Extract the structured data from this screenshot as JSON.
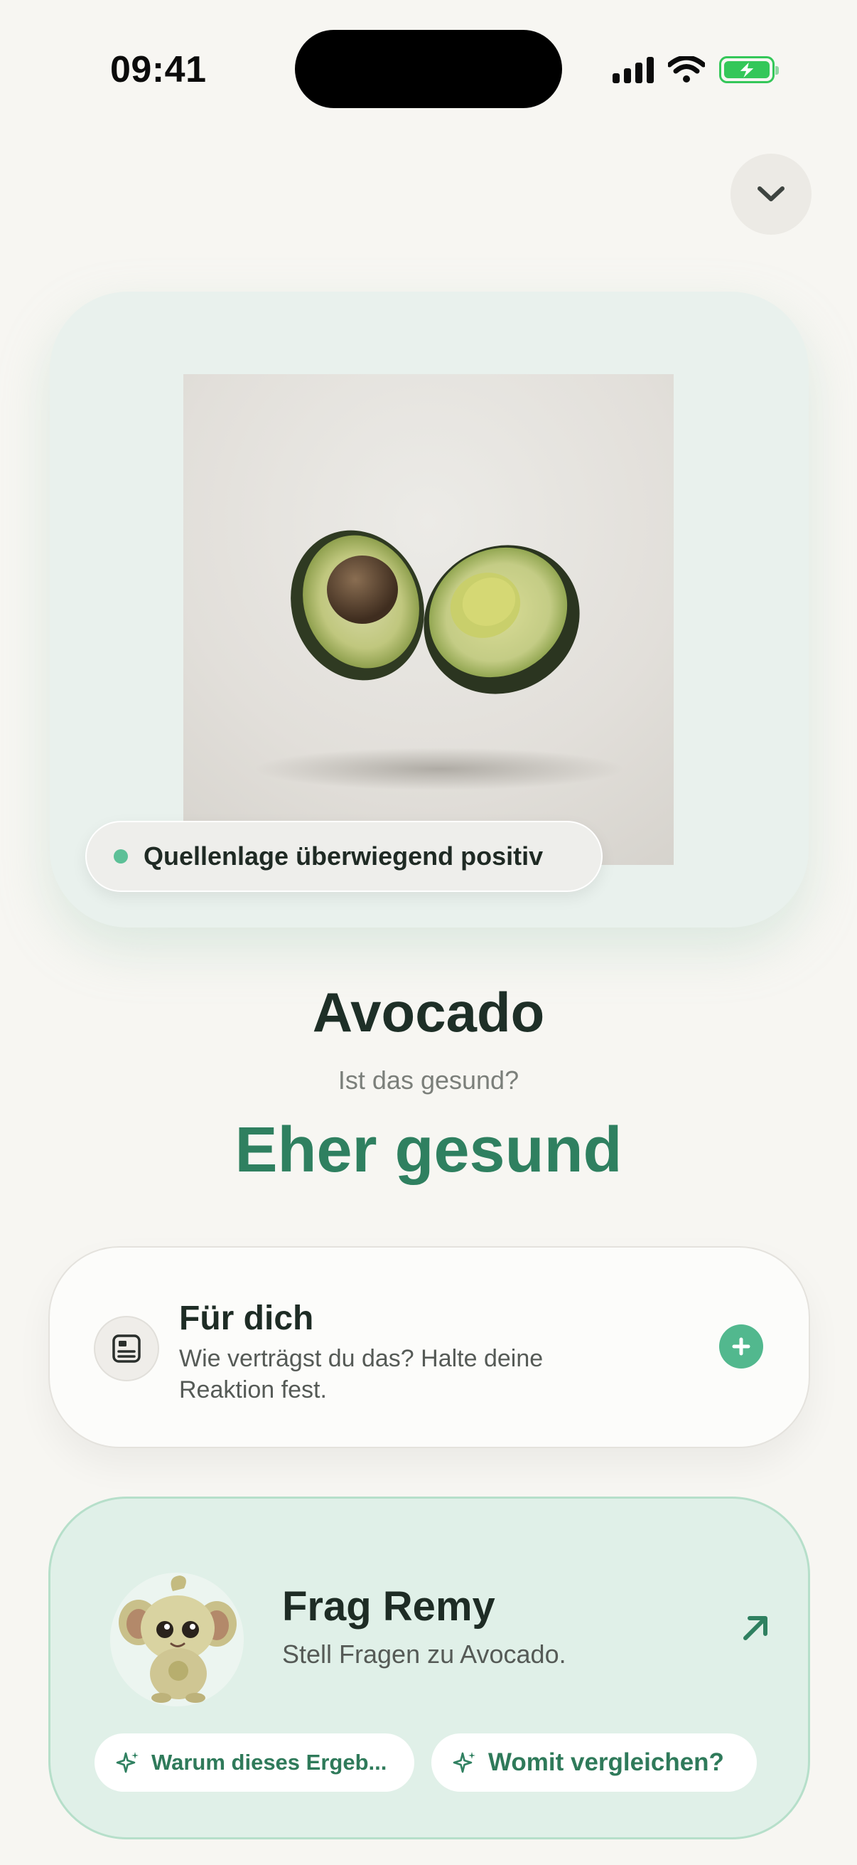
{
  "status_bar": {
    "time": "09:41"
  },
  "hero": {
    "source_badge": "Quellenlage überwiegend positiv"
  },
  "food": {
    "name": "Avocado",
    "question": "Ist das gesund?",
    "verdict": "Eher gesund"
  },
  "for_you": {
    "title": "Für dich",
    "subtitle": "Wie verträgst du das? Halte deine Reaktion fest."
  },
  "remy": {
    "title": "Frag Remy",
    "subtitle": "Stell Fragen zu Avocado.",
    "chips": [
      "Warum dieses Ergeb...",
      "Womit vergleichen?"
    ]
  },
  "colors": {
    "accent": "#2f8060",
    "accent_light": "#52b88e",
    "badge_dot": "#5cc097",
    "remy_bg": "#e0f0e8"
  }
}
